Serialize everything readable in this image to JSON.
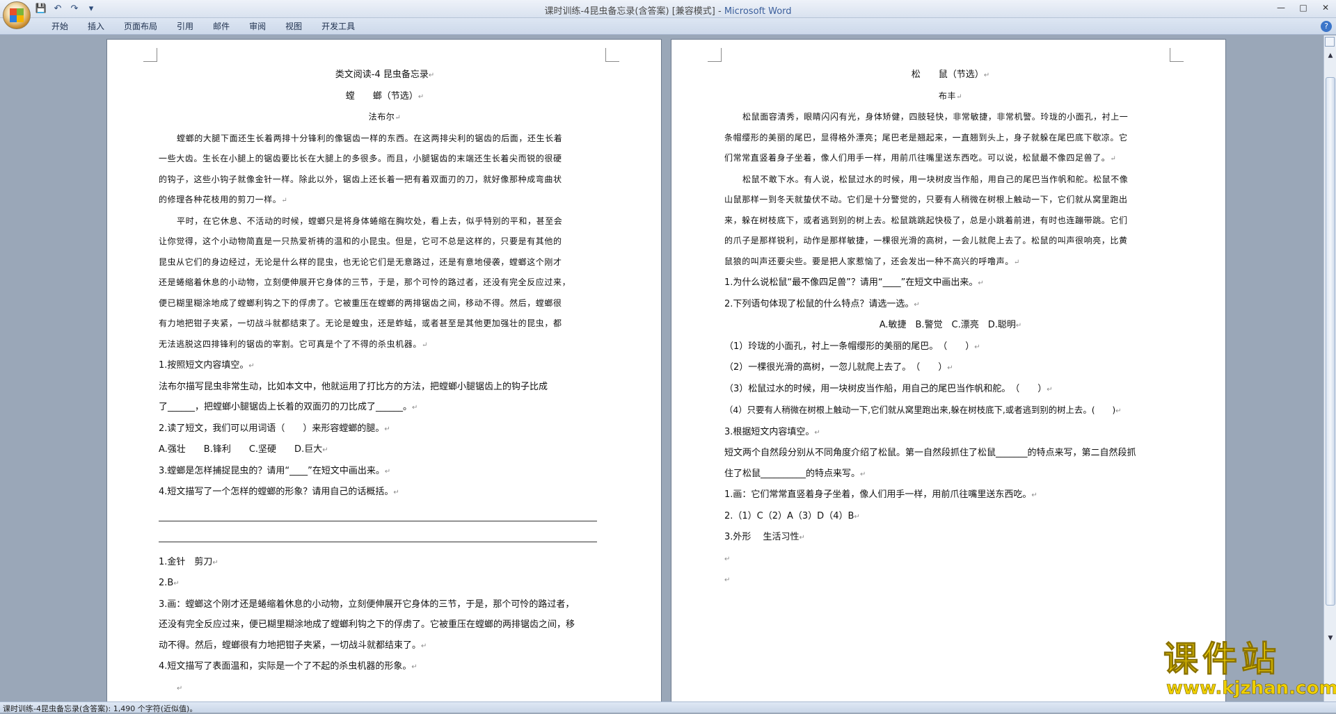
{
  "window": {
    "title_doc": "课时训练-4昆虫备忘录(含答案) [兼容模式] - ",
    "title_app": "Microsoft Word",
    "controls": {
      "minimize": "—",
      "maximize": "□",
      "close": "✕"
    }
  },
  "ribbon": {
    "tabs": [
      "开始",
      "插入",
      "页面布局",
      "引用",
      "邮件",
      "审阅",
      "视图",
      "开发工具"
    ],
    "help": "?"
  },
  "page1": {
    "title": "类文阅读-4 昆虫备忘录",
    "subtitle": "螳　　螂（节选）",
    "author": "法布尔",
    "para1": [
      "螳螂的大腿下面还生长着两排十分锋利的像锯齿一样的东西。在这两排尖利的锯齿的后面，还生长着",
      "一些大齿。生长在小腿上的锯齿要比长在大腿上的多很多。而且，小腿锯齿的末端还生长着尖而锐的很硬",
      "的钩子，这些小钩子就像金针一样。除此以外，锯齿上还长着一把有着双面刃的刀，就好像那种成弯曲状",
      "的修理各种花枝用的剪刀一样。"
    ],
    "para2": [
      "平时，在它休息、不活动的时候，螳螂只是将身体蜷缩在胸坎处，看上去，似乎特别的平和，甚至会",
      "让你觉得，这个小动物简直是一只热爱祈祷的温和的小昆虫。但是，它可不总是这样的，只要是有其他的",
      "昆虫从它们的身边经过，无论是什么样的昆虫，也无论它们是无意路过，还是有意地侵袭，螳螂这个刚才",
      "还是蜷缩着休息的小动物，立刻便伸展开它身体的三节，于是，那个可怜的路过者，还没有完全反应过来，",
      "便已糊里糊涂地成了螳螂利钩之下的俘虏了。它被重压在螳螂的两排锯齿之间，移动不得。然后，螳螂很",
      "有力地把钳子夹紧，一切战斗就都结束了。无论是蝗虫，还是蚱蜢，或者甚至是其他更加强壮的昆虫，都",
      "无法逃脱这四排锋利的锯齿的宰割。它可真是个了不得的杀虫机器。"
    ],
    "q1": "1.按照短文内容填空。",
    "q1_l1": "法布尔描写昆虫非常生动，比如本文中，他就运用了打比方的方法，把螳螂小腿锯齿上的钩子比成",
    "q1_l2": "了______，把螳螂小腿锯齿上长着的双面刃的刀比成了______。",
    "q2": "2.读了短文，我们可以用词语（　　）来形容螳螂的腿。",
    "q2_opts": "A.强壮　　B.锋利　　C.坚硬　　D.巨大",
    "q3": "3.螳螂是怎样捕捉昆虫的？请用“____”在短文中画出来。",
    "q4": "4.短文描写了一个怎样的螳螂的形象？请用自己的话概括。",
    "a1": "1.金针　剪刀",
    "a2": "2.B",
    "a3_l1": "3.画：螳螂这个刚才还是蜷缩着休息的小动物，立刻便伸展开它身体的三节，于是，那个可怜的路过者，",
    "a3_l2": "还没有完全反应过来，便已糊里糊涂地成了螳螂利钩之下的俘虏了。它被重压在螳螂的两排锯齿之间，移",
    "a3_l3": "动不得。然后，螳螂很有力地把钳子夹紧，一切战斗就都结束了。",
    "a4": "4.短文描写了表面温和，实际是一个了不起的杀虫机器的形象。"
  },
  "page2": {
    "title": "松　　鼠（节选）",
    "author": "布丰",
    "para1": [
      "松鼠面容清秀，眼睛闪闪有光，身体矫健，四肢轻快，非常敏捷，非常机警。玲珑的小面孔，衬上一",
      "条帽缨形的美丽的尾巴，显得格外漂亮；尾巴老是翘起来，一直翘到头上，身子就躲在尾巴底下歇凉。它",
      "们常常直竖着身子坐着，像人们用手一样，用前爪往嘴里送东西吃。可以说，松鼠最不像四足兽了。"
    ],
    "para2": [
      "松鼠不敢下水。有人说，松鼠过水的时候，用一块树皮当作船，用自己的尾巴当作帆和舵。松鼠不像",
      "山鼠那样一到冬天就蛰伏不动。它们是十分警觉的，只要有人稍微在树根上触动一下，它们就从窝里跑出",
      "来，躲在树枝底下，或者逃到别的树上去。松鼠跳跳起快极了，总是小跳着前进，有时也连蹦带跳。它们",
      "的爪子是那样锐利，动作是那样敏捷，一棵很光滑的高树，一会儿就爬上去了。松鼠的叫声很响亮，比黄",
      "鼠狼的叫声还要尖些。要是把人家惹恼了，还会发出一种不高兴的呼噜声。"
    ],
    "q1": "1.为什么说松鼠“最不像四足兽”？请用“____”在短文中画出来。",
    "q2": "2.下列语句体现了松鼠的什么特点？请选一选。",
    "q2_opts": "A.敏捷　B.警觉　C.漂亮　D.聪明",
    "q2_items": [
      "（1）玲珑的小面孔，衬上一条帽缨形的美丽的尾巴。　（　　）",
      "（2）一棵很光滑的高树，一忽儿就爬上去了。　（　　）",
      "（3）松鼠过水的时候，用一块树皮当作船，用自己的尾巴当作帆和舵。　（　　）",
      "（4）只要有人稍微在树根上触动一下,它们就从窝里跑出来,躲在树枝底下,或者逃到别的树上去。(　　)"
    ],
    "q3": "3.根据短文内容填空。",
    "q3_l1": "短文两个自然段分别从不同角度介绍了松鼠。第一自然段抓住了松鼠_______的特点来写，第二自然段抓",
    "q3_l2": "住了松鼠__________的特点来写。",
    "a1": "1.画：它们常常直竖着身子坐着，像人们用手一样，用前爪往嘴里送东西吃。",
    "a2": "2.（1）C（2）A（3）D（4）B",
    "a3": "3.外形　 生活习性"
  },
  "marks": {
    "para": "↵"
  },
  "statusbar": {
    "text": "课时训练-4昆虫备忘录(含答案): 1,490 个字符(近似值)。"
  },
  "watermark": {
    "logo": "课件站",
    "url": "www.kjzhan.com"
  }
}
